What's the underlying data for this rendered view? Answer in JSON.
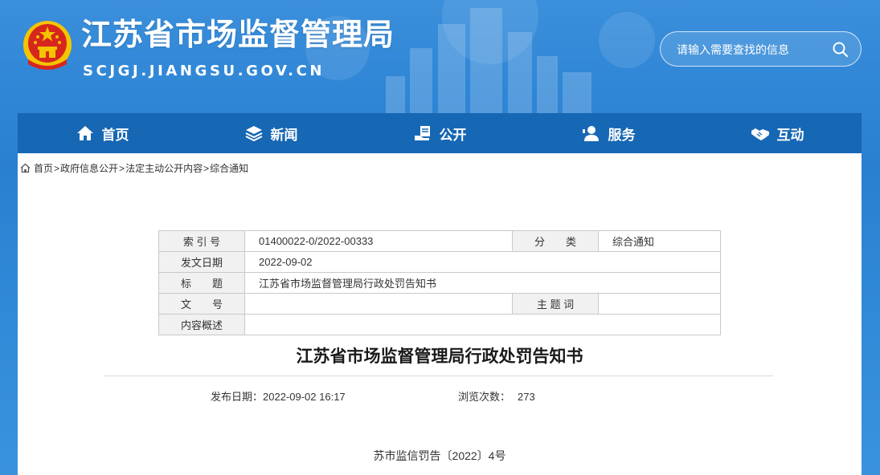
{
  "header": {
    "site_title": "江苏省市场监督管理局",
    "site_domain": "SCJGJ.JIANGSU.GOV.CN",
    "search_placeholder": "请输入需要查找的信息"
  },
  "nav": {
    "items": [
      {
        "label": "首页",
        "icon": "home-icon"
      },
      {
        "label": "新闻",
        "icon": "layers-icon"
      },
      {
        "label": "公开",
        "icon": "hand-document-icon"
      },
      {
        "label": "服务",
        "icon": "user-service-icon"
      },
      {
        "label": "互动",
        "icon": "handshake-icon"
      }
    ]
  },
  "breadcrumb": [
    "首页",
    "政府信息公开",
    "法定主动公开内容",
    "综合通知"
  ],
  "meta": {
    "index_label": "索 引 号",
    "index_value": "01400022-0/2022-00333",
    "category_label": "分　　类",
    "category_value": "综合通知",
    "date_label": "发文日期",
    "date_value": "2022-09-02",
    "title_label": "标　　题",
    "title_value": "江苏省市场监督管理局行政处罚告知书",
    "doc_label": "文　　号",
    "doc_value": "",
    "subject_label": "主 题 词",
    "subject_value": "",
    "summary_label": "内容概述",
    "summary_value": ""
  },
  "article": {
    "title": "江苏省市场监督管理局行政处罚告知书",
    "publish_date_label": "发布日期：",
    "publish_date": "2022-09-02 16:17",
    "views_label": "浏览次数：",
    "views": "273",
    "doc_number": "苏市监信罚告〔2022〕4号"
  },
  "colors": {
    "banner": "#2f86d6",
    "nav": "#1667b4",
    "emblem_red": "#d7261e",
    "emblem_gold": "#f5c400"
  }
}
